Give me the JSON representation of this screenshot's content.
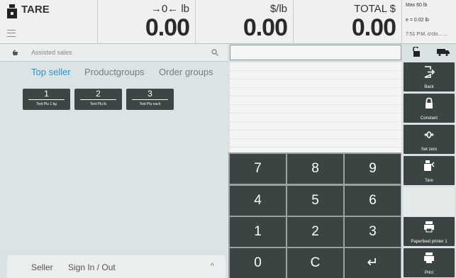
{
  "header": {
    "tare_label": "TARE",
    "weight_unit": "→0← lb",
    "weight_value": "0.00",
    "price_unit": "$/lb",
    "price_value": "0.00",
    "total_unit": "TOTAL $",
    "total_value": "0.00",
    "max_text": "Max 60 lb",
    "e_text": "e = 0.02 lb",
    "time_text": "7:51 P.M. o'clo... ..."
  },
  "search": {
    "placeholder": "Assisted sales"
  },
  "tabs": [
    {
      "label": "Top seller",
      "active": true
    },
    {
      "label": "Productgroups",
      "active": false
    },
    {
      "label": "Order groups",
      "active": false
    }
  ],
  "plu_buttons": [
    {
      "number": "1",
      "name": "Test Plu 1 kg"
    },
    {
      "number": "2",
      "name": "Test Plu lb"
    },
    {
      "number": "3",
      "name": "Test Plu each"
    }
  ],
  "footer": {
    "seller_label": "Seller",
    "sign_label": "Sign In / Out",
    "caret": "^"
  },
  "keypad": [
    "7",
    "8",
    "9",
    "4",
    "5",
    "6",
    "1",
    "2",
    "3",
    "0",
    "C",
    "↵"
  ],
  "side_buttons": {
    "back": "Back",
    "constant": "Constant",
    "set_zero": "Set zero",
    "tare": "Tare",
    "paperfeed": "Paperfeed printer 1",
    "print": "Print"
  },
  "colors": {
    "accent": "#2f8fd8",
    "key_bg": "#3a4442",
    "panel_bg": "#d8e2e2"
  }
}
